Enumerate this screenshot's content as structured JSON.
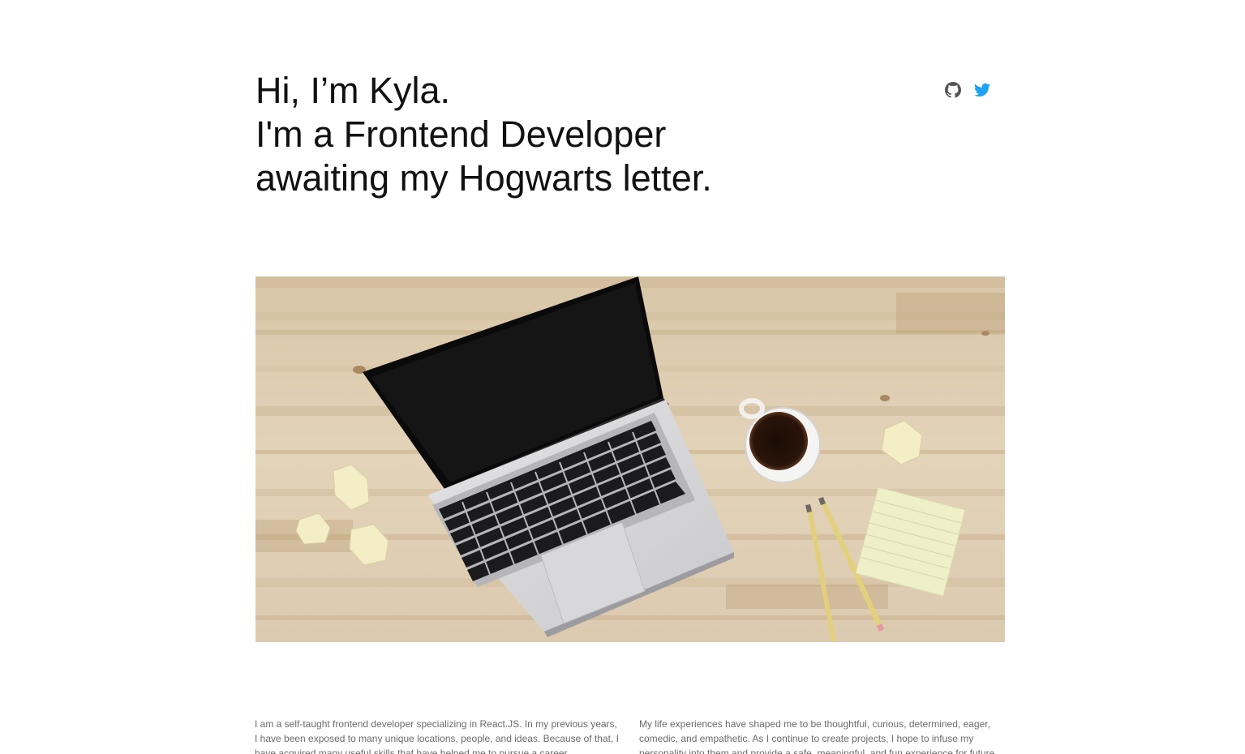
{
  "header": {
    "line1": "Hi, I’m Kyla.",
    "line2": "I'm a Frontend Developer",
    "line3": "awaiting my Hogwarts letter."
  },
  "social": {
    "github_icon": "github-icon",
    "twitter_icon": "twitter-icon",
    "github_color": "#555555",
    "twitter_color": "#1da1f2"
  },
  "hero_image": {
    "description_icon": "laptop-desk-photo"
  },
  "bio": {
    "paragraph1": "I am a self-taught frontend developer specializing in React.JS. In my previous years, I have been exposed to many unique locations, people, and ideas. Because of that, I have acquired many useful skills that have helped me to pursue a career",
    "paragraph2": "My life experiences have shaped me to be thoughtful, curious, determined, eager, comedic, and empathetic. As I continue to create projects, I hope to infuse my personality into them and provide a safe, meaningful, and fun experience for future"
  }
}
